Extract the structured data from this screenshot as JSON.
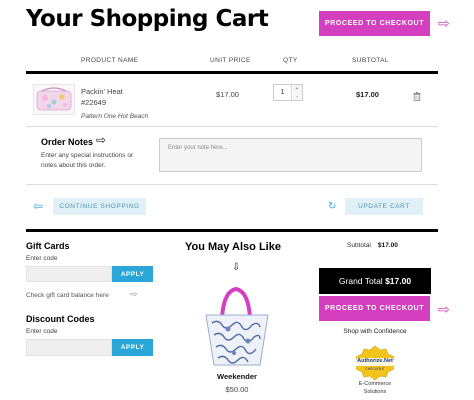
{
  "page": {
    "title": "Your Shopping Cart"
  },
  "header": {
    "checkout_label": "PROCEED TO CHECKOUT"
  },
  "table": {
    "headers": [
      "PRODUCT NAME",
      "UNIT PRICE",
      "QTY",
      "SUBTOTAL"
    ],
    "items": [
      {
        "name": "Packin' Heat",
        "sku": "#22649",
        "pattern": "Pattern One Hot Beach",
        "unit_price": "$17.00",
        "qty": "1",
        "subtotal": "$17.00"
      }
    ]
  },
  "notes": {
    "title": "Order Notes",
    "description_line1": "Enter any special instructions or",
    "description_line2": "notes about this order.",
    "placeholder": "Enter your note here..."
  },
  "actions": {
    "continue_label": "CONTINUE SHOPPING",
    "update_label": "UPDATE CART"
  },
  "gift": {
    "title": "Gift Cards",
    "enter_code": "Enter code",
    "apply_label": "APPLY",
    "balance_link": "Check gift card balance here"
  },
  "discount": {
    "title": "Discount Codes",
    "enter_code": "Enter code",
    "apply_label": "APPLY"
  },
  "recommend": {
    "title": "You May Also Like",
    "product_name": "Weekender",
    "product_price": "$50.00"
  },
  "summary": {
    "subtotal_label": "Subtotal",
    "subtotal_value": "$17.00",
    "grand_label": "Grand Total",
    "grand_value": "$17.00",
    "checkout_label": "PROCEED TO CHECKOUT",
    "confidence": "Shop with Confidence",
    "seal_brand": "Authorize.Net",
    "seal_sub": "CHECKOUT",
    "seal_line1": "E-Commerce",
    "seal_line2": "Solutions"
  },
  "colors": {
    "accent": "#d43fbf",
    "apply": "#2aa7d8",
    "light_button": "#dff1f7"
  }
}
